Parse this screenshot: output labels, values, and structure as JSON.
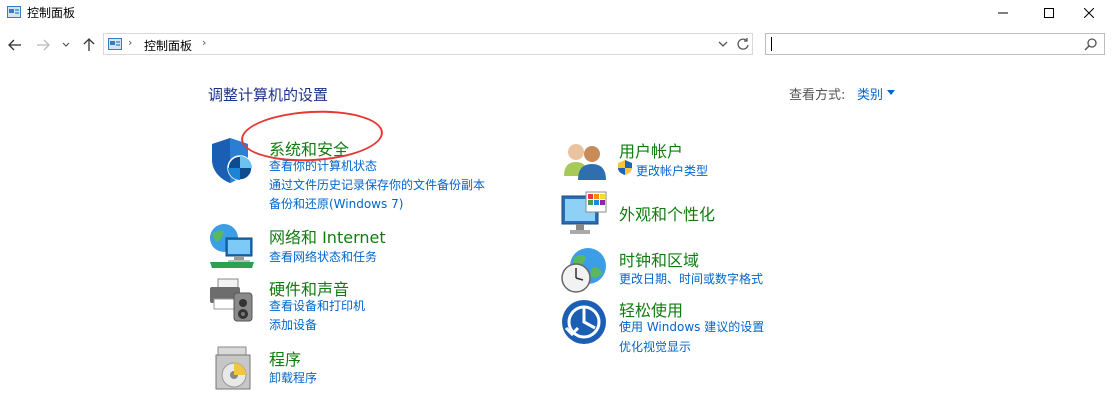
{
  "window": {
    "title": "控制面板"
  },
  "address": {
    "crumb": "控制面板",
    "separator": "›"
  },
  "search": {
    "placeholder": ""
  },
  "header": {
    "title": "调整计算机的设置",
    "view_by_label": "查看方式:",
    "view_by_value": "类别"
  },
  "categories": {
    "system_security": {
      "title": "系统和安全",
      "links": [
        "查看你的计算机状态",
        "通过文件历史记录保存你的文件备份副本",
        "备份和还原(Windows 7)"
      ]
    },
    "network": {
      "title": "网络和 Internet",
      "links": [
        "查看网络状态和任务"
      ]
    },
    "hardware": {
      "title": "硬件和声音",
      "links": [
        "查看设备和打印机",
        "添加设备"
      ]
    },
    "programs": {
      "title": "程序",
      "links": [
        "卸载程序"
      ]
    },
    "user_accounts": {
      "title": "用户帐户",
      "links": [
        "更改帐户类型"
      ]
    },
    "appearance": {
      "title": "外观和个性化",
      "links": []
    },
    "clock_region": {
      "title": "时钟和区域",
      "links": [
        "更改日期、时间或数字格式"
      ]
    },
    "ease_of_access": {
      "title": "轻松使用",
      "links": [
        "使用 Windows 建议的设置",
        "优化视觉显示"
      ]
    }
  },
  "colors": {
    "link": "#0066cc",
    "category_title": "#107c10",
    "header": "#1e3287",
    "annotation": "#e53935"
  }
}
